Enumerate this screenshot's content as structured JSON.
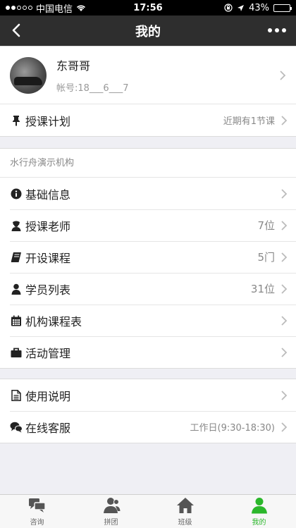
{
  "status_bar": {
    "carrier": "中国电信",
    "time": "17:56",
    "battery": "43%",
    "battery_level": 0.43
  },
  "nav": {
    "title": "我的",
    "back_icon": "chevron-left-icon",
    "more_icon": "more-dots-icon"
  },
  "profile": {
    "name": "东哥哥",
    "account": "帐号:18___6___7"
  },
  "plan_row": {
    "label": "授课计划",
    "value": "近期有1节课",
    "icon": "pin-icon"
  },
  "org": {
    "name": "水行舟演示机构",
    "items": [
      {
        "label": "基础信息",
        "value": "",
        "icon": "info-icon"
      },
      {
        "label": "授课老师",
        "value": "7位",
        "icon": "teacher-icon"
      },
      {
        "label": "开设课程",
        "value": "5门",
        "icon": "book-icon"
      },
      {
        "label": "学员列表",
        "value": "31位",
        "icon": "user-icon"
      },
      {
        "label": "机构课程表",
        "value": "",
        "icon": "calendar-icon"
      },
      {
        "label": "活动管理",
        "value": "",
        "icon": "briefcase-icon"
      }
    ]
  },
  "help": {
    "items": [
      {
        "label": "使用说明",
        "value": "",
        "icon": "document-icon"
      },
      {
        "label": "在线客服",
        "value": "工作日(9:30-18:30)",
        "icon": "chat-icon"
      }
    ]
  },
  "tabs": [
    {
      "label": "咨询",
      "icon": "chat-bubbles-icon",
      "active": false
    },
    {
      "label": "拼团",
      "icon": "group-icon",
      "active": false
    },
    {
      "label": "班级",
      "icon": "home-icon",
      "active": false
    },
    {
      "label": "我的",
      "icon": "person-icon",
      "active": true
    }
  ],
  "colors": {
    "nav_bg": "#2e2e2e",
    "active_tab": "#2bb72b",
    "page_bg": "#efeff4"
  }
}
